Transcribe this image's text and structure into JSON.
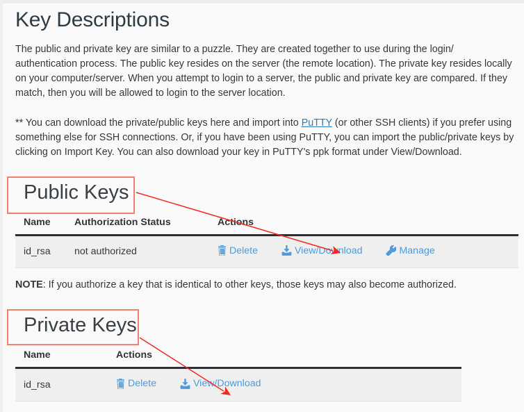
{
  "page": {
    "title": "Key Descriptions",
    "paragraph_1": "The public and private key are similar to a puzzle. They are created together to use during the login/ authentication process. The public key resides on the server (the remote location). The private key resides locally on your computer/server. When you attempt to login to a server, the public and private key are compared. If they match, then you will be allowed to login to the server location.",
    "paragraph_2_part1": "** You can download the private/public keys here and import into ",
    "paragraph_2_link": "PuTTY",
    "paragraph_2_part2": " (or other SSH clients) if you prefer using something else for SSH connections. Or, if you have been using PuTTY, you can import the public/private keys by clicking on Import Key. You can also download your key in PuTTY's ppk format under View/Download.",
    "note_label": "NOTE",
    "note_text": ": If you authorize a key that is identical to other keys, those keys may also become authorized."
  },
  "public_keys": {
    "heading": "Public Keys",
    "columns": [
      "Name",
      "Authorization Status",
      "Actions"
    ],
    "rows": [
      {
        "name": "id_rsa",
        "status": "not authorized",
        "actions": [
          {
            "label": "Delete",
            "icon": "trash-icon"
          },
          {
            "label": "View/Download",
            "icon": "download-icon"
          },
          {
            "label": "Manage",
            "icon": "wrench-icon"
          }
        ]
      }
    ]
  },
  "private_keys": {
    "heading": "Private Keys",
    "columns": [
      "Name",
      "Actions"
    ],
    "rows": [
      {
        "name": "id_rsa",
        "actions": [
          {
            "label": "Delete",
            "icon": "trash-icon"
          },
          {
            "label": "View/Download",
            "icon": "download-icon"
          }
        ]
      }
    ]
  },
  "annotations": {
    "box_color": "#f08070",
    "arrow_color": "#ef2b20",
    "boxes": [
      "public-keys-highlight",
      "private-keys-highlight"
    ],
    "arrows": [
      "public-keys-to-view-download",
      "private-keys-to-view-download"
    ]
  },
  "colors": {
    "link": "#4e9ada",
    "inline_link": "#2b7bbf",
    "row_bg": "#efefef",
    "page_bg": "#fafafa",
    "header_rule": "#2b2f33"
  }
}
